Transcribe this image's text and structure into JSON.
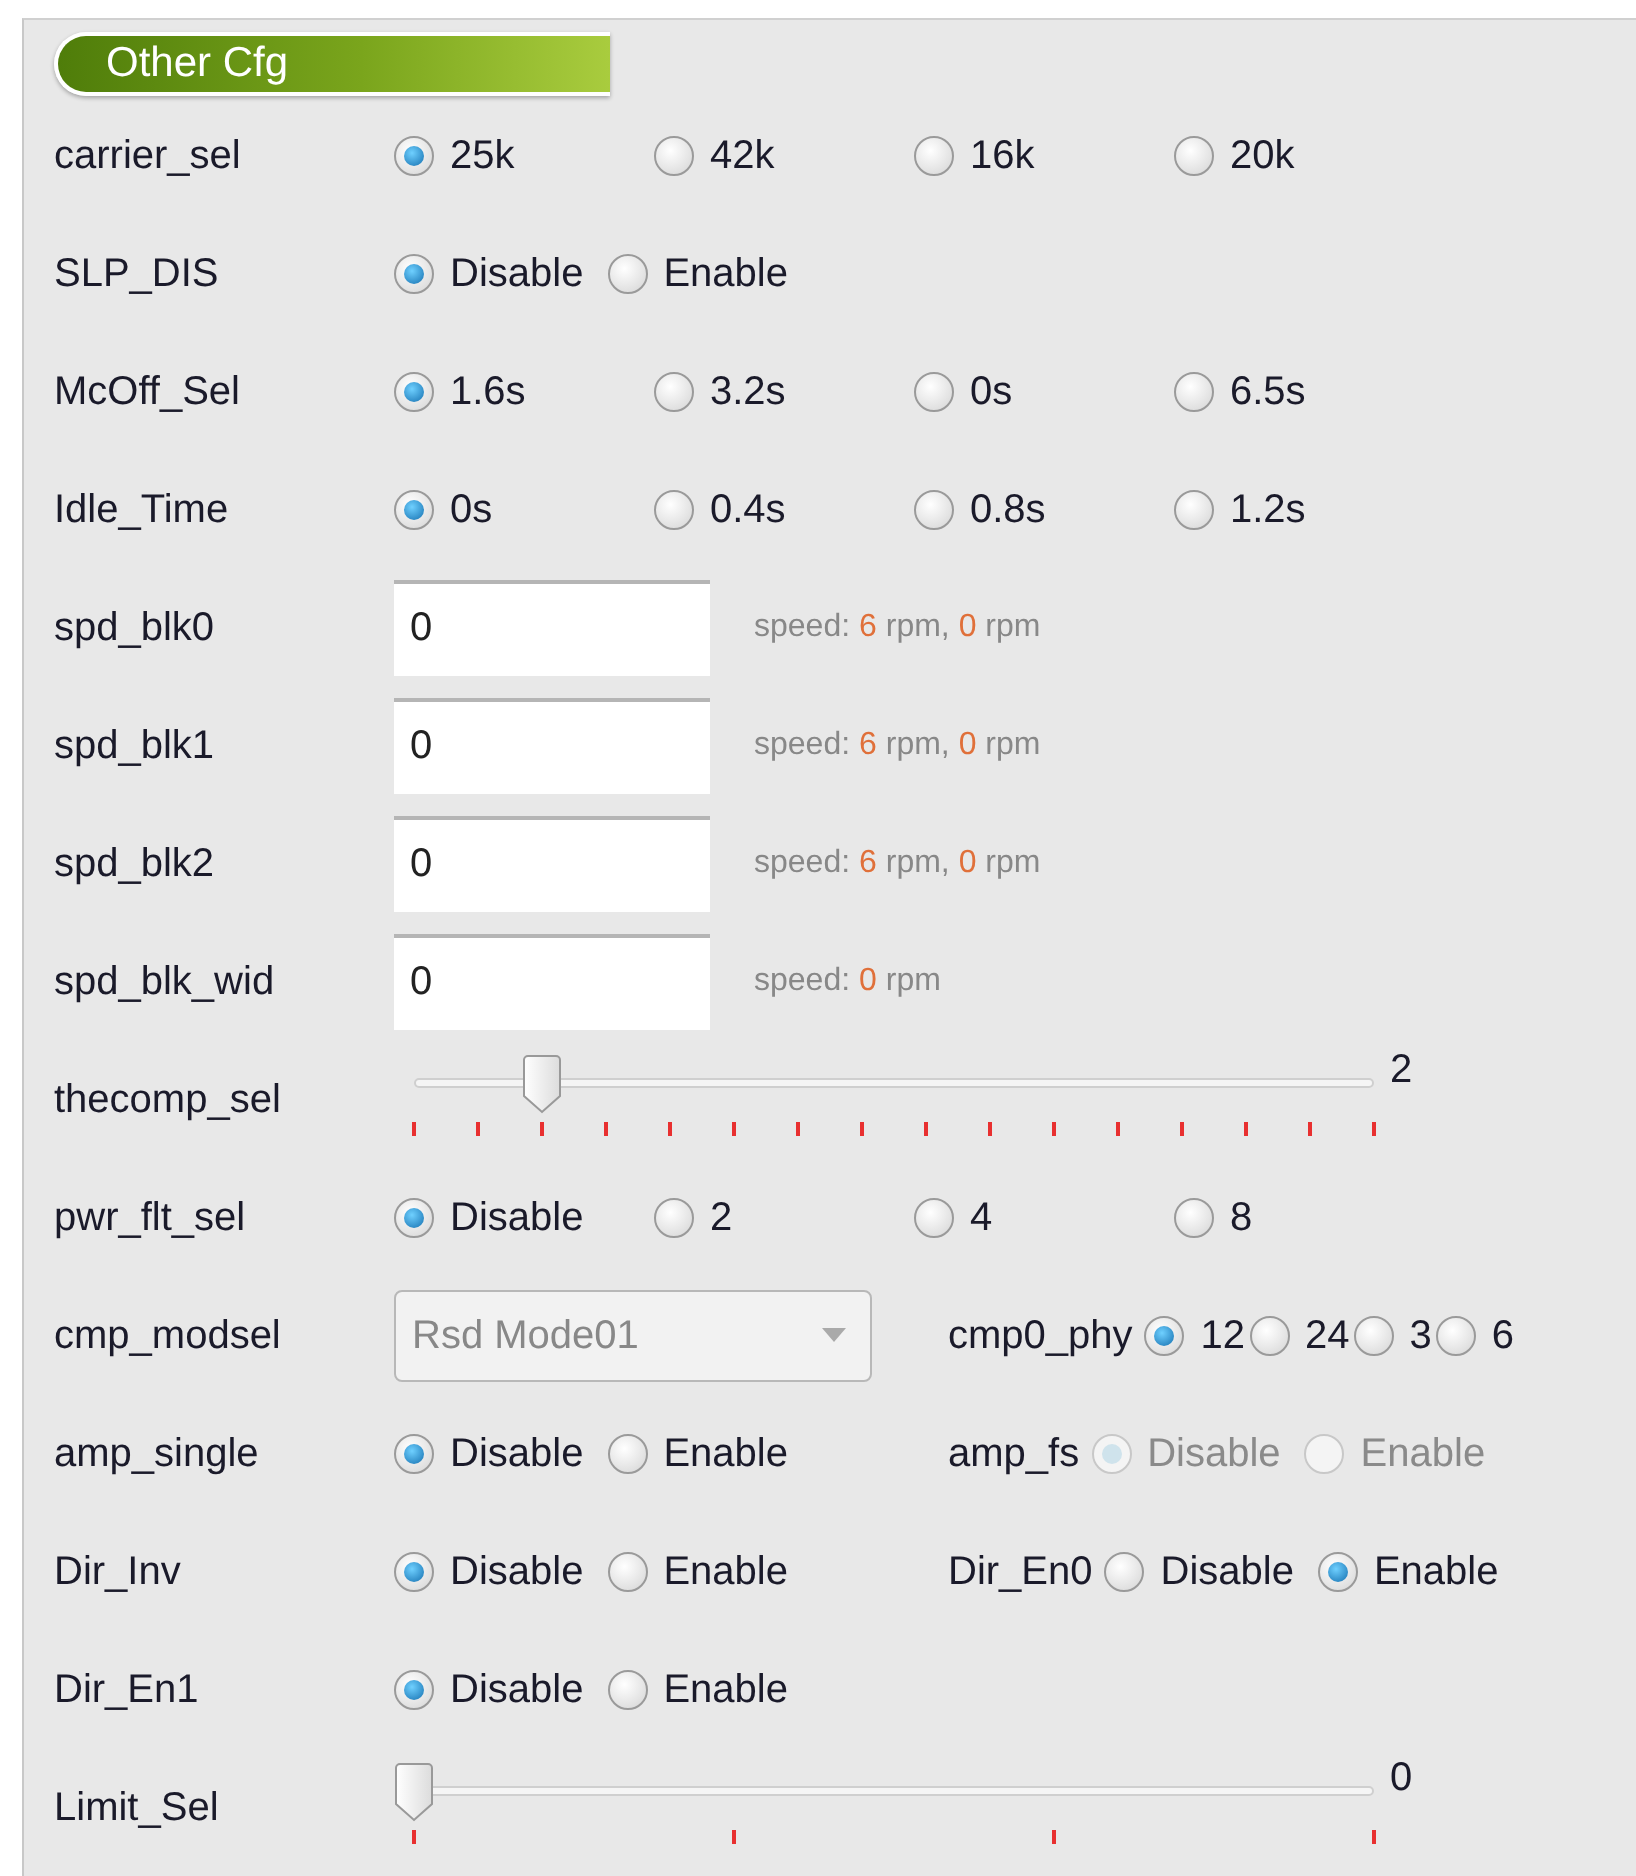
{
  "section_title": "Other Cfg",
  "rows": [
    {
      "label": "carrier_sel",
      "kind": "radio",
      "options": [
        {
          "label": "25k",
          "selected": true
        },
        {
          "label": "42k",
          "selected": false
        },
        {
          "label": "16k",
          "selected": false
        },
        {
          "label": "20k",
          "selected": false
        }
      ]
    },
    {
      "label": "SLP_DIS",
      "kind": "radio",
      "options": [
        {
          "label": "Disable",
          "selected": true
        },
        {
          "label": "Enable",
          "selected": false
        }
      ]
    },
    {
      "label": "McOff_Sel",
      "kind": "radio",
      "options": [
        {
          "label": "1.6s",
          "selected": true
        },
        {
          "label": "3.2s",
          "selected": false
        },
        {
          "label": "0s",
          "selected": false
        },
        {
          "label": "6.5s",
          "selected": false
        }
      ]
    },
    {
      "label": "Idle_Time",
      "kind": "radio",
      "options": [
        {
          "label": "0s",
          "selected": true
        },
        {
          "label": "0.4s",
          "selected": false
        },
        {
          "label": "0.8s",
          "selected": false
        },
        {
          "label": "1.2s",
          "selected": false
        }
      ]
    },
    {
      "label": "spd_blk0",
      "kind": "input",
      "value": "0",
      "hint": [
        {
          "text": "speed:",
          "kind": "plain"
        },
        {
          "text": "6",
          "kind": "value"
        },
        {
          "text": "rpm,",
          "kind": "plain"
        },
        {
          "text": "0",
          "kind": "value"
        },
        {
          "text": "rpm",
          "kind": "plain"
        }
      ]
    },
    {
      "label": "spd_blk1",
      "kind": "input",
      "value": "0",
      "hint": [
        {
          "text": "speed:",
          "kind": "plain"
        },
        {
          "text": "6",
          "kind": "value"
        },
        {
          "text": "rpm,",
          "kind": "plain"
        },
        {
          "text": "0",
          "kind": "value"
        },
        {
          "text": "rpm",
          "kind": "plain"
        }
      ]
    },
    {
      "label": "spd_blk2",
      "kind": "input",
      "value": "0",
      "hint": [
        {
          "text": "speed:",
          "kind": "plain"
        },
        {
          "text": "6",
          "kind": "value"
        },
        {
          "text": "rpm,",
          "kind": "plain"
        },
        {
          "text": "0",
          "kind": "value"
        },
        {
          "text": "rpm",
          "kind": "plain"
        }
      ]
    },
    {
      "label": "spd_blk_wid",
      "kind": "input",
      "value": "0",
      "hint": [
        {
          "text": "speed:",
          "kind": "plain"
        },
        {
          "text": "0",
          "kind": "value"
        },
        {
          "text": "rpm",
          "kind": "plain"
        }
      ]
    },
    {
      "label": "thecomp_sel",
      "kind": "slider",
      "level": 0.133,
      "reading": "2"
    },
    {
      "label": "pwr_flt_sel",
      "kind": "radio",
      "options": [
        {
          "label": "Disable",
          "selected": true
        },
        {
          "label": "2",
          "selected": false
        },
        {
          "label": "4",
          "selected": false
        },
        {
          "label": "8",
          "selected": false
        }
      ]
    },
    {
      "label": "cmp_modsel",
      "kind": "select",
      "value": "Rsd Mode01",
      "extra": {
        "label": "cmp0_phy",
        "disabled": false,
        "options": [
          {
            "label": "12",
            "selected": true
          },
          {
            "label": "24",
            "selected": false
          },
          {
            "label": "3",
            "selected": false
          },
          {
            "label": "6",
            "selected": false
          }
        ]
      }
    },
    {
      "label": "amp_single",
      "kind": "radio",
      "options": [
        {
          "label": "Disable",
          "selected": true
        },
        {
          "label": "Enable",
          "selected": false
        }
      ],
      "extra": {
        "label": "amp_fs",
        "disabled": true,
        "options": [
          {
            "label": "Disable",
            "selected": true
          },
          {
            "label": "Enable",
            "selected": false
          }
        ]
      }
    },
    {
      "label": "Dir_Inv",
      "kind": "radio",
      "options": [
        {
          "label": "Disable",
          "selected": true
        },
        {
          "label": "Enable",
          "selected": false
        }
      ],
      "extra": {
        "label": "Dir_En0",
        "disabled": false,
        "options": [
          {
            "label": "Disable",
            "selected": false
          },
          {
            "label": "Enable",
            "selected": true
          }
        ]
      }
    },
    {
      "label": "Dir_En1",
      "kind": "radio",
      "options": [
        {
          "label": "Disable",
          "selected": true
        },
        {
          "label": "Enable",
          "selected": false
        }
      ]
    },
    {
      "label": "Limit_Sel",
      "kind": "slider",
      "level": 0,
      "reading": "0"
    }
  ]
}
